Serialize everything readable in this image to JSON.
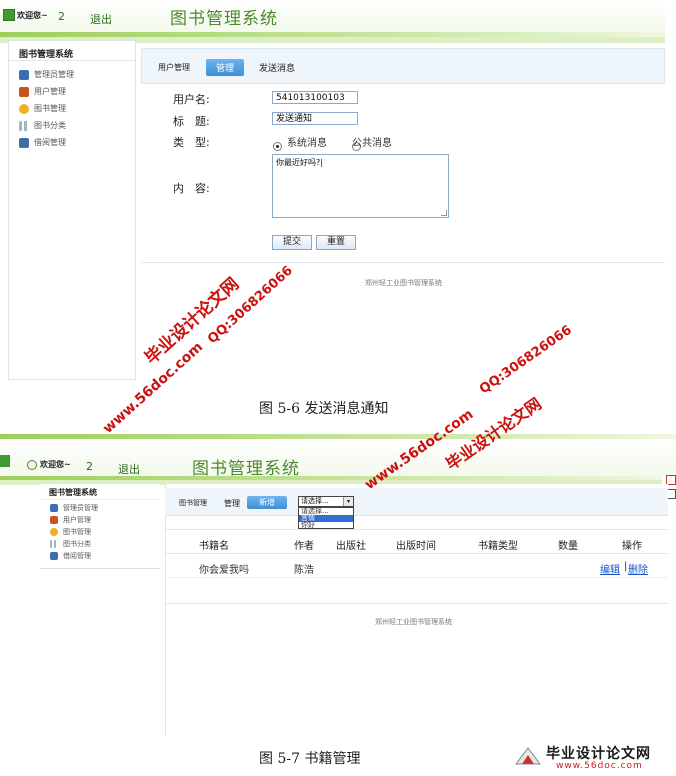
{
  "shot1": {
    "welcome": "欢迎您~",
    "user_num": "2",
    "logout": "退出",
    "system_title": "图书管理系统",
    "menu_title": "图书管理系统",
    "menu": [
      "管理员管理",
      "用户管理",
      "图书管理",
      "图书分类",
      "借阅管理"
    ],
    "tabs": {
      "user": "用户管理",
      "manage": "管理",
      "send": "发送消息"
    },
    "form": {
      "username_label": "用户名:",
      "username_value": "541013100103",
      "title_label": "标　题:",
      "title_value": "发送通知",
      "type_label": "类　型:",
      "type_option_1": "系统消息",
      "type_option_2": "公共消息",
      "content_label": "内　容:",
      "content_value": "你最近好吗?|",
      "submit": "提交",
      "reset": "重置"
    },
    "footer": "郑州轻工业图书管理系统"
  },
  "caption1": "图 5-6 发送消息通知",
  "shot2": {
    "welcome": "欢迎您~",
    "user_num": "2",
    "logout": "退出",
    "system_title": "图书管理系统",
    "menu_title": "图书管理系统",
    "menu": [
      "管理员管理",
      "用户管理",
      "图书管理",
      "图书分类",
      "借阅管理"
    ],
    "tabs": {
      "books": "图书管理",
      "manage": "管理",
      "add": "新增"
    },
    "select": {
      "value": "请选择...",
      "options": [
        "请选择...",
        "言情",
        "你好"
      ]
    },
    "table": {
      "headers": [
        "书籍名",
        "作者",
        "出版社",
        "出版时间",
        "书籍类型",
        "数量",
        "操作"
      ],
      "rows": [
        {
          "name": "你会爱我吗",
          "author": "陈浩",
          "edit": "编辑",
          "sep": "|",
          "delete": "删除"
        }
      ]
    },
    "footer": "郑州轻工业图书管理系统"
  },
  "caption2": "图 5-7 书籍管理",
  "watermark": {
    "site": "毕业设计论文网",
    "qq": "QQ:306826066",
    "url": "www.56doc.com"
  },
  "brand": {
    "name": "毕业设计论文网",
    "url": "www.56doc.com"
  }
}
